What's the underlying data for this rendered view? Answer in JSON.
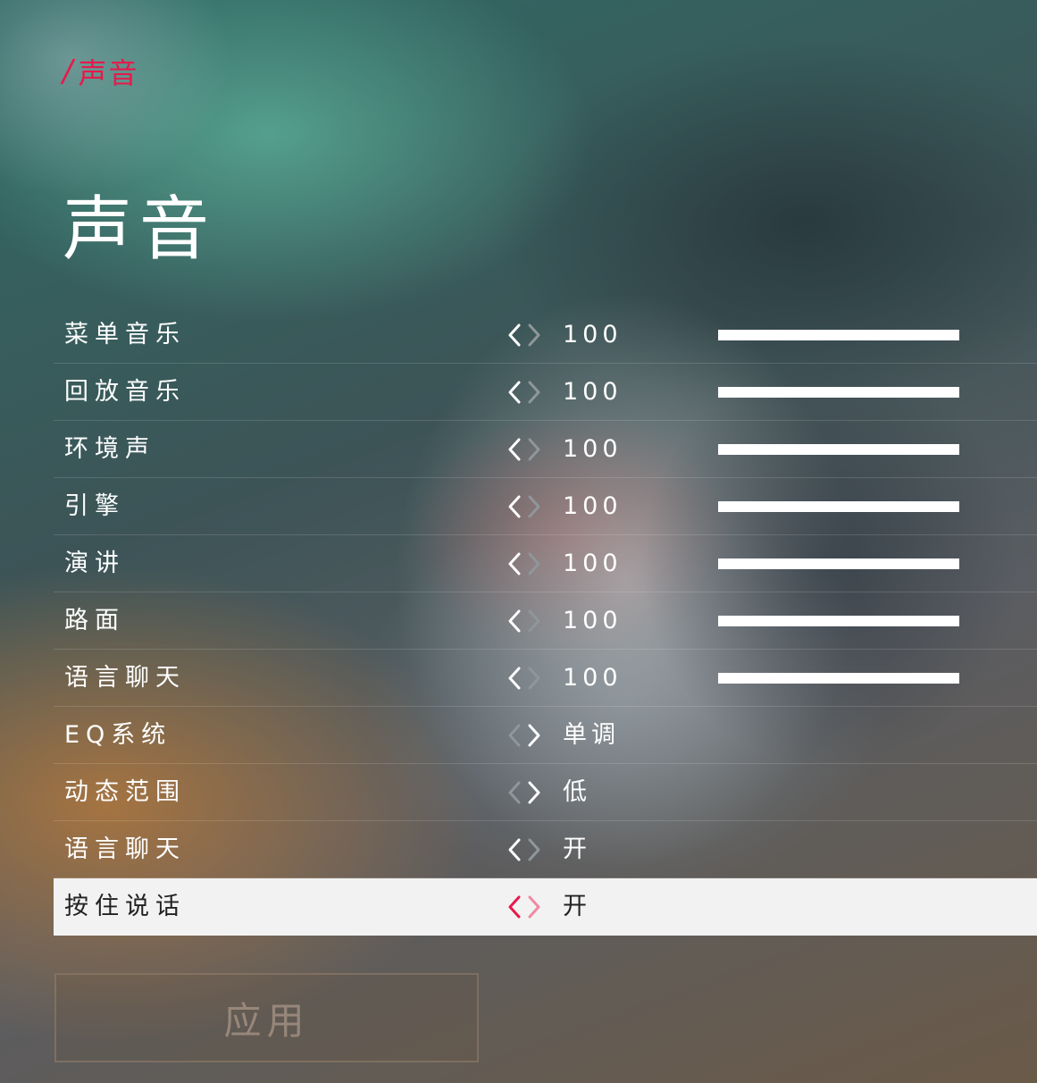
{
  "breadcrumb": {
    "slash": "/",
    "label": "声音"
  },
  "page": {
    "title": "声音"
  },
  "settings": [
    {
      "label": "菜单音乐",
      "value": "100",
      "slider": 1.0
    },
    {
      "label": "回放音乐",
      "value": "100",
      "slider": 1.0
    },
    {
      "label": "环境声",
      "value": "100",
      "slider": 1.0
    },
    {
      "label": "引擎",
      "value": "100",
      "slider": 1.0
    },
    {
      "label": "演讲",
      "value": "100",
      "slider": 1.0
    },
    {
      "label": "路面",
      "value": "100",
      "slider": 1.0
    },
    {
      "label": "语言聊天",
      "value": "100",
      "slider": 1.0
    },
    {
      "label": "EQ系统",
      "value": "单调"
    },
    {
      "label": "动态范围",
      "value": "低"
    },
    {
      "label": "语言聊天",
      "value": "开"
    },
    {
      "label": "按住说话",
      "value": "开",
      "selected": true
    }
  ],
  "apply": {
    "label": "应用"
  },
  "colors": {
    "accent": "#e8194a",
    "text": "#ffffff",
    "selected_bg": "#f2f2f2",
    "arrow_inactive": "#8f979a"
  },
  "icons": {
    "left": "chevron-left-icon",
    "right": "chevron-right-icon"
  }
}
